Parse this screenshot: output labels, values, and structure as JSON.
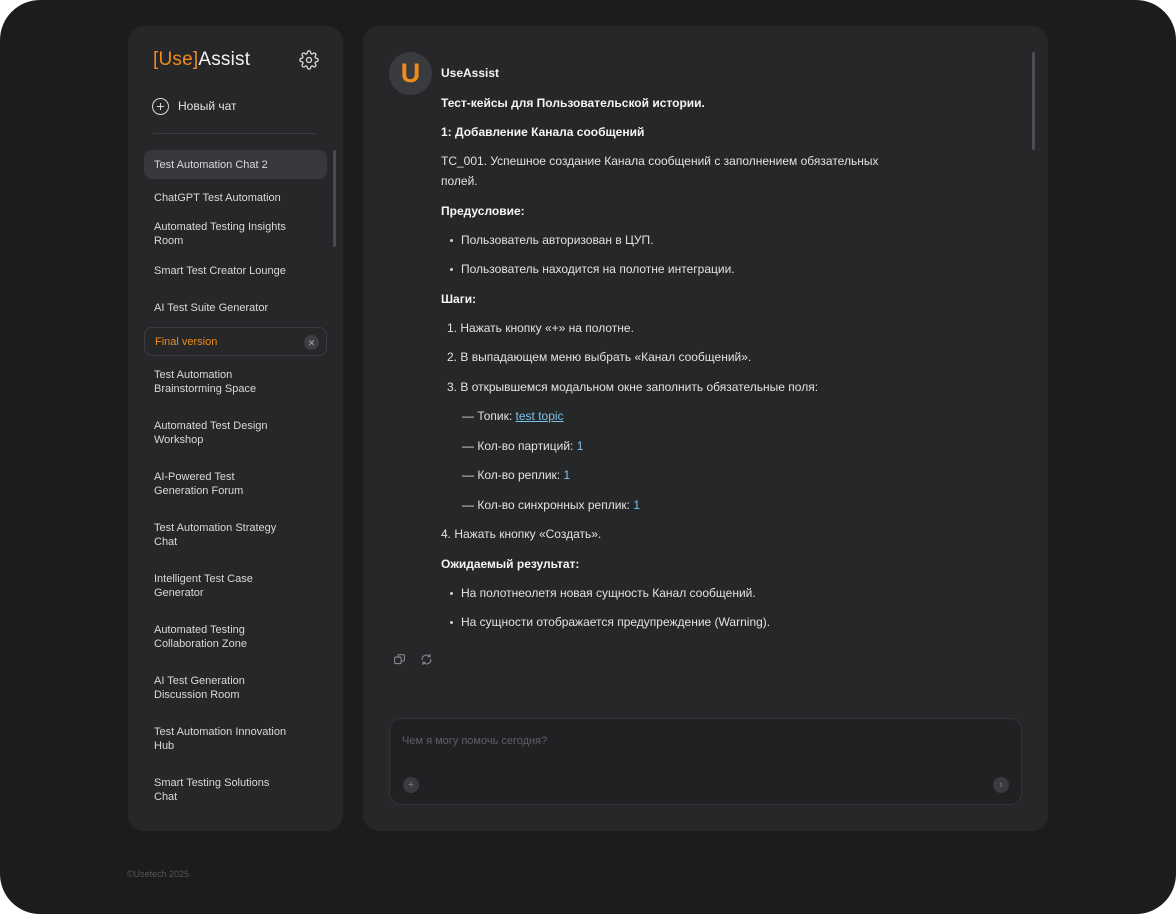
{
  "app": {
    "logo_accent": "[Use]",
    "logo_rest": "Assist",
    "accent_color": "#f08a1c",
    "link_color": "#7cc2e6"
  },
  "sidebar": {
    "new_chat_label": "Новый чат",
    "settings_icon": "gear-icon",
    "items": [
      {
        "label": "Test Automation Chat 2",
        "state": "active"
      },
      {
        "label": "ChatGPT Test Automation"
      },
      {
        "label": "Automated Testing Insights Room"
      },
      {
        "label": "Smart Test Creator Lounge"
      },
      {
        "label": "AI Test Suite Generator"
      },
      {
        "label": "Final version",
        "state": "editing"
      },
      {
        "label": "Test Automation Brainstorming Space"
      },
      {
        "label": "Automated Test Design Workshop"
      },
      {
        "label": "AI-Powered Test Generation Forum"
      },
      {
        "label": "Test Automation Strategy Chat"
      },
      {
        "label": "Intelligent Test Case Generator"
      },
      {
        "label": "Automated Testing Collaboration Zone"
      },
      {
        "label": "AI Test Generation Discussion Room"
      },
      {
        "label": "Test Automation Innovation Hub"
      },
      {
        "label": "Smart Testing Solutions Chat"
      }
    ]
  },
  "footer": {
    "copyright": "©Usetech 2025"
  },
  "message": {
    "avatar_letter": "U",
    "sender": "UseAssist",
    "title": "Тест-кейсы для Пользовательской истории.",
    "section": "1: Добавление Канала сообщений",
    "case_line1": "TC_001. Успешное создание Канала сообщений с заполнением обязательных",
    "case_line2": "полей.",
    "precondition_heading": "Предусловие:",
    "preconditions": [
      "Пользователь авторизован в ЦУП.",
      "Пользователь находится на полотне интеграции."
    ],
    "steps_heading": "Шаги:",
    "steps": [
      {
        "n": "1.",
        "text": "Нажать кнопку «+» на полотне."
      },
      {
        "n": "2.",
        "text": "В выпадающем меню выбрать «Канал сообщений»."
      },
      {
        "n": "3.",
        "text": "В открывшемся модальном окне заполнить обязательные поля:"
      }
    ],
    "fields": [
      {
        "label": "— Топик: ",
        "value": "test topic"
      },
      {
        "label": "— Кол-во партиций: ",
        "value": "1"
      },
      {
        "label": "— Кол-во реплик: ",
        "value": "1"
      },
      {
        "label": "— Кол-во синхронных реплик: ",
        "value": "1"
      }
    ],
    "step4": "4. Нажать кнопку «Создать».",
    "expected_heading": "Ожидаемый результат:",
    "expected": [
      "На полотнеолетя новая сущность Канал сообщений.",
      "На сущности отображается предупреждение (Warning)."
    ]
  },
  "composer": {
    "placeholder": "Чем я могу помочь сегодня?",
    "attach_label": "+",
    "send_label": "›"
  }
}
